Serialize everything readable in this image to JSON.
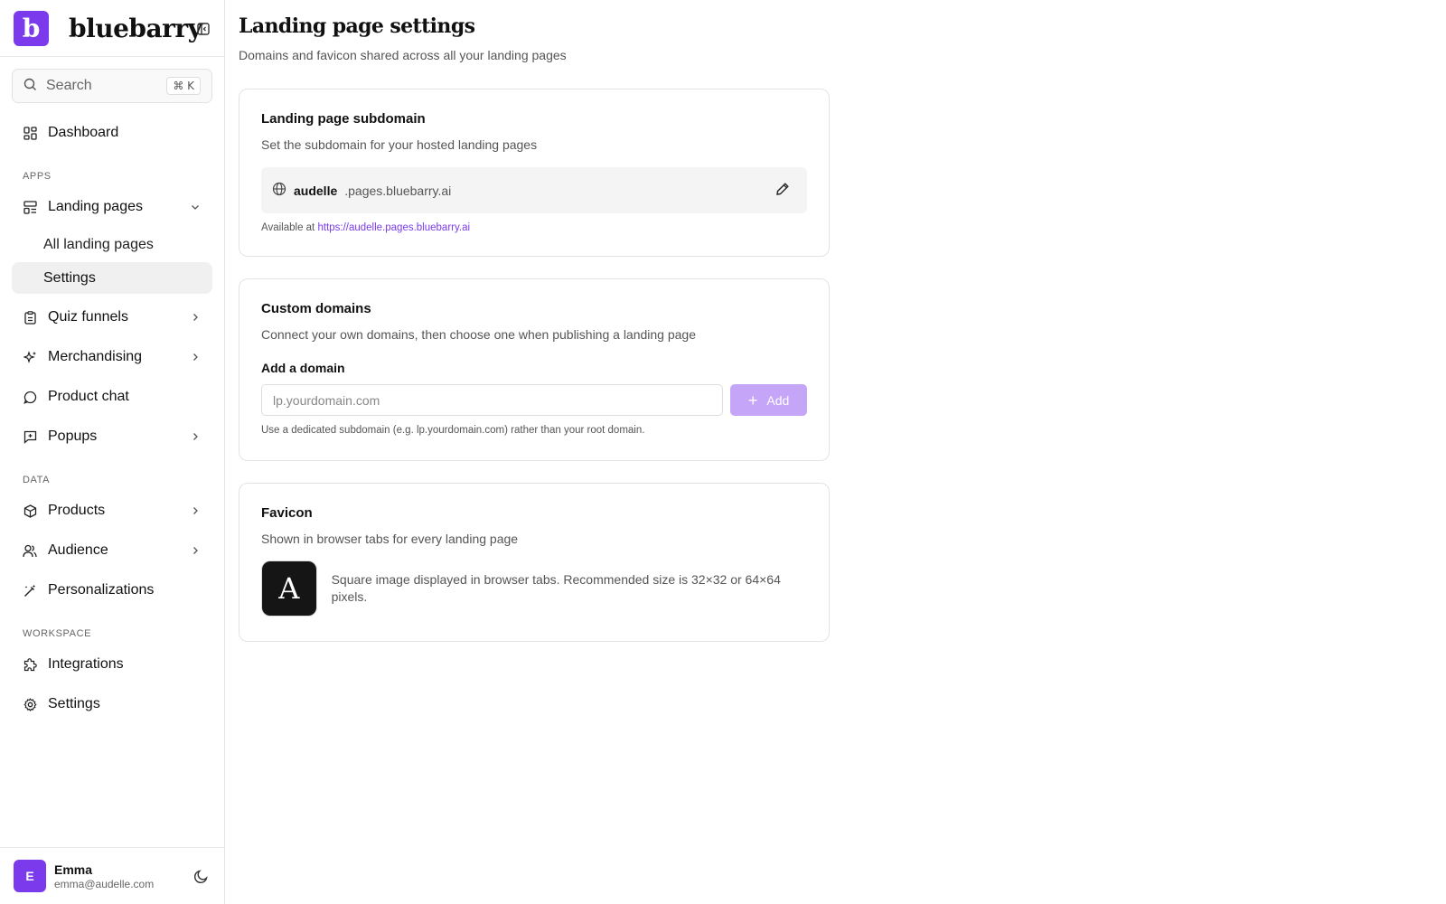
{
  "brand": {
    "logo_letter": "b",
    "name": "bluebarry"
  },
  "search": {
    "placeholder": "Search",
    "shortcut": "⌘ K"
  },
  "nav": {
    "dashboard": "Dashboard",
    "section_apps": "APPS",
    "landing_pages": "Landing pages",
    "landing_sub": [
      "All landing pages",
      "Settings"
    ],
    "quiz_funnels": "Quiz funnels",
    "merchandising": "Merchandising",
    "product_chat": "Product chat",
    "popups": "Popups",
    "section_data": "DATA",
    "products": "Products",
    "audience": "Audience",
    "personalizations": "Personalizations",
    "section_workspace": "WORKSPACE",
    "integrations": "Integrations",
    "settings": "Settings"
  },
  "user": {
    "initial": "E",
    "name": "Emma",
    "email": "emma@audelle.com"
  },
  "page": {
    "title": "Landing page settings",
    "subtitle": "Domains and favicon shared across all your landing pages"
  },
  "subdomain_card": {
    "title": "Landing page subdomain",
    "description": "Set the subdomain for your hosted landing pages",
    "subdomain": "audelle",
    "suffix": ".pages.bluebarry.ai",
    "available_prefix": "Available at",
    "available_url": "https://audelle.pages.bluebarry.ai"
  },
  "custom_domains_card": {
    "title": "Custom domains",
    "description": "Connect your own domains, then choose one when publishing a landing page",
    "field_label": "Add a domain",
    "input_placeholder": "lp.yourdomain.com",
    "add_label": "Add",
    "hint": "Use a dedicated subdomain (e.g. lp.yourdomain.com) rather than your root domain."
  },
  "favicon_card": {
    "title": "Favicon",
    "description": "Shown in browser tabs for every landing page",
    "favicon_letter": "A",
    "info": "Square image displayed in browser tabs. Recommended size is 32×32 or 64×64 pixels."
  },
  "colors": {
    "accent": "#7c3aed",
    "accent_light": "#c4a5f7",
    "link": "#7c3aed"
  }
}
